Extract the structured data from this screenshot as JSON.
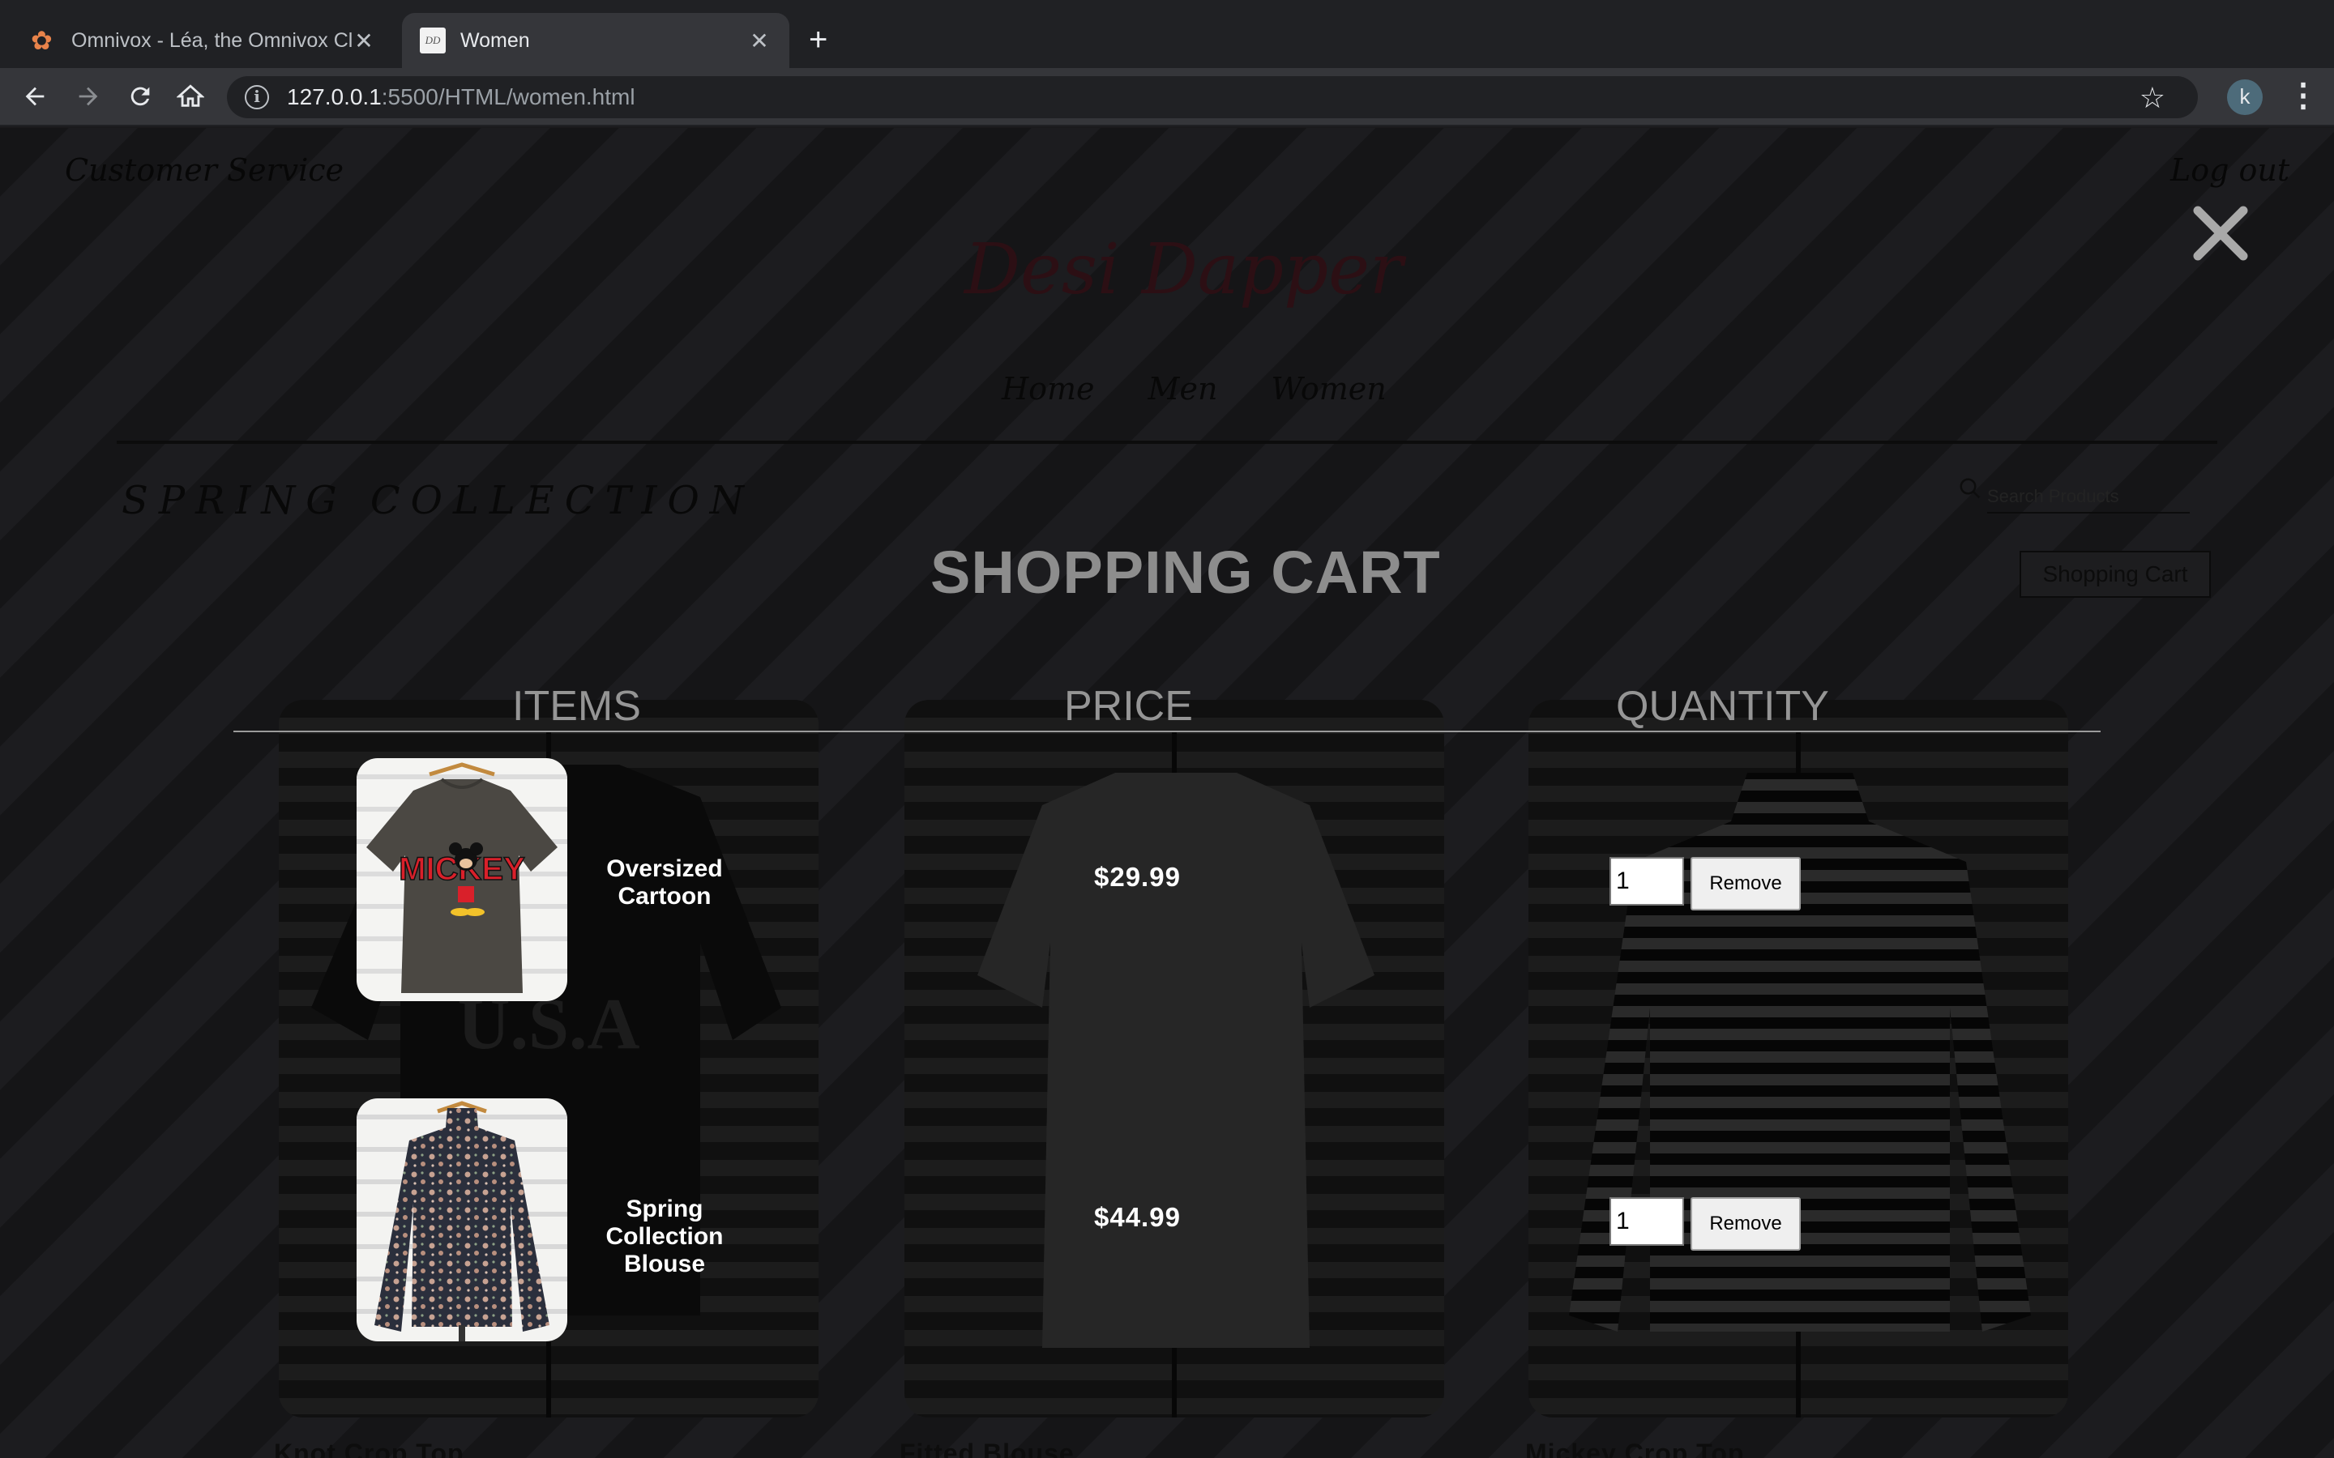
{
  "browser": {
    "tabs": [
      {
        "title": "Omnivox - Léa, the Omnivox Cl",
        "favicon": "omnivox-flower-icon",
        "active": false
      },
      {
        "title": "Women",
        "favicon": "desi-dapper-favicon",
        "active": true
      }
    ],
    "url_host": "127.0.0.1",
    "url_path": ":5500/HTML/women.html",
    "profile_initial": "k"
  },
  "site": {
    "customer_service": "Customer Service",
    "logout": "Log out",
    "brand": "Desi Dapper",
    "nav": [
      "Home",
      "Men",
      "Women"
    ],
    "section_title": "SPRING COLLECTION",
    "search_placeholder": "Search Products",
    "cart_button": "Shopping Cart",
    "products": [
      "Knot Crop Top",
      "Fitted Blouse",
      "Mickey Crop Top"
    ]
  },
  "cart": {
    "title": "SHOPPING CART",
    "columns": [
      "ITEMS",
      "PRICE",
      "QUANTITY"
    ],
    "items": [
      {
        "name": "Oversized Cartoon",
        "price": "$29.99",
        "quantity": "1",
        "remove_label": "Remove"
      },
      {
        "name": "Spring Collection Blouse",
        "price": "$44.99",
        "quantity": "1",
        "remove_label": "Remove"
      }
    ]
  },
  "colors": {
    "overlay_text": "#8d8d8d",
    "brand": "#2c0f14",
    "chrome_bg": "#202124",
    "mickey_red": "#d9202a"
  }
}
